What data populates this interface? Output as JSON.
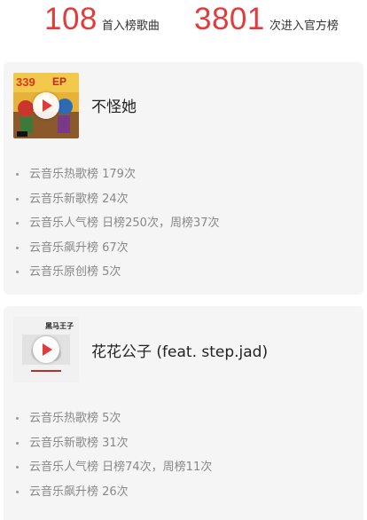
{
  "stats": [
    {
      "number": "108",
      "label": "首入榜歌曲"
    },
    {
      "number": "3801",
      "label": "次进入官方榜"
    }
  ],
  "songs": [
    {
      "title": "不怪她",
      "cover_badge": "EP",
      "ranks": [
        "云音乐热歌榜 179次",
        "云音乐新歌榜 24次",
        "云音乐人气榜 日榜250次，周榜37次",
        "云音乐飙升榜 67次",
        "云音乐原创榜 5次"
      ]
    },
    {
      "title": "花花公子 (feat. step.jad)",
      "cover_badge": "黑马王子",
      "ranks": [
        "云音乐热歌榜 5次",
        "云音乐新歌榜 31次",
        "云音乐人气榜 日榜74次，周榜11次",
        "云音乐飙升榜 26次"
      ]
    }
  ],
  "colors": {
    "accent": "#e13c3c",
    "card_bg": "#f5f5f5",
    "rank_text": "#888888"
  },
  "icons": {
    "cover_play": "play-icon",
    "rank_bullet": "dot-icon"
  }
}
